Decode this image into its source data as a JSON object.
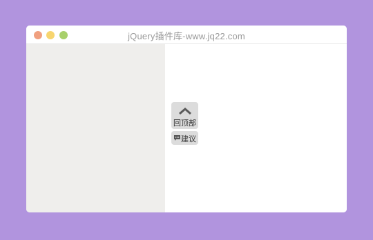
{
  "window": {
    "title": "jQuery插件库-www.jq22.com",
    "traffic_lights": {
      "close_color": "#f0a07f",
      "minimize_color": "#f7d56f",
      "maximize_color": "#a8d06b"
    }
  },
  "colors": {
    "background": "#b194de",
    "left_pane": "#efeeec",
    "right_pane": "#ffffff",
    "float_button": "#dcdcdc"
  },
  "float_toolbar": {
    "back_to_top": {
      "icon": "chevron-up-icon",
      "label": "回顶部"
    },
    "suggestion": {
      "icon": "message-icon",
      "label": "建议"
    }
  }
}
